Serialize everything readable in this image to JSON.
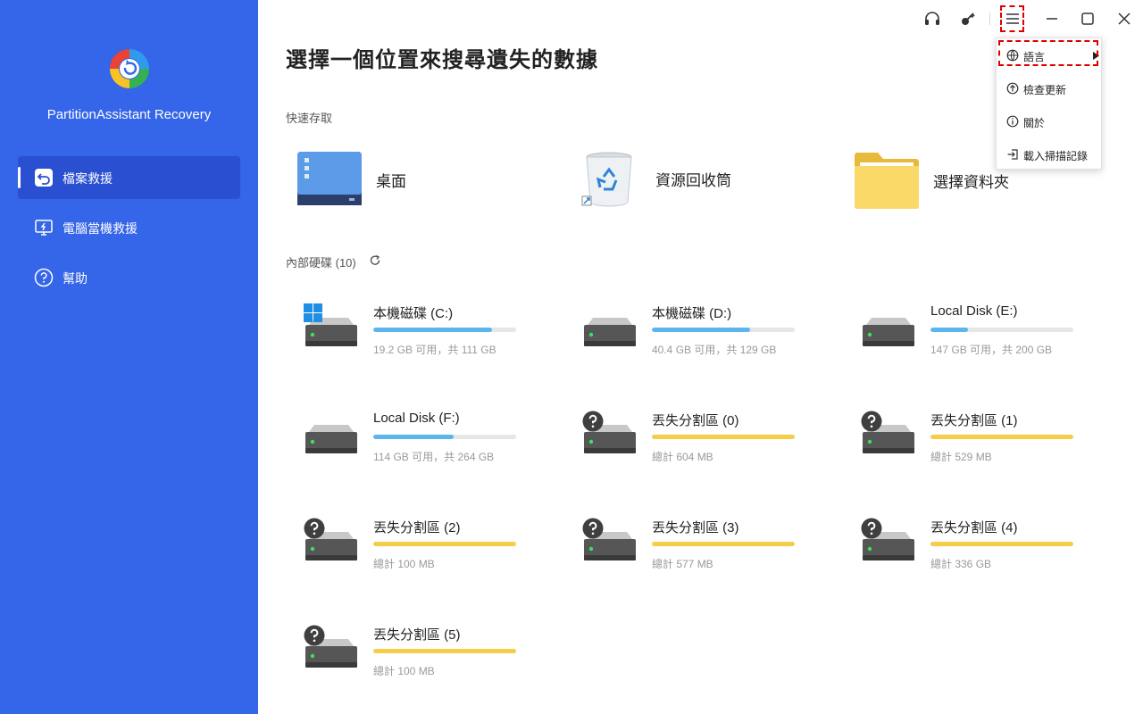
{
  "sidebar": {
    "app_name": "PartitionAssistant Recovery",
    "nav": [
      {
        "label": "檔案救援",
        "icon": "undo-file-icon",
        "active": true
      },
      {
        "label": "電腦當機救援",
        "icon": "monitor-crash-icon",
        "active": false
      },
      {
        "label": "幫助",
        "icon": "help-icon",
        "active": false
      }
    ]
  },
  "main": {
    "title": "選擇一個位置來搜尋遺失的數據",
    "quick_access_label": "快速存取",
    "quick_access": [
      {
        "label": "桌面",
        "icon": "desktop-icon"
      },
      {
        "label": "資源回收筒",
        "icon": "recycle-bin-icon"
      },
      {
        "label": "選擇資料夾",
        "icon": "folder-icon"
      }
    ],
    "disks_label": "內部硬碟 (10)",
    "disks": [
      {
        "name": "本機磁碟 (C:)",
        "info": "19.2 GB 可用，共 111 GB",
        "used": 0.83,
        "type": "system"
      },
      {
        "name": "本機磁碟 (D:)",
        "info": "40.4 GB 可用，共 129 GB",
        "used": 0.69,
        "type": "normal"
      },
      {
        "name": "Local Disk (E:)",
        "info": "147 GB 可用，共 200 GB",
        "used": 0.26,
        "type": "normal"
      },
      {
        "name": "Local Disk (F:)",
        "info": "114 GB 可用，共 264 GB",
        "used": 0.56,
        "type": "normal"
      },
      {
        "name": "丟失分割區 (0)",
        "info": "總計 604 MB",
        "used": 1.0,
        "type": "lost"
      },
      {
        "name": "丟失分割區 (1)",
        "info": "總計 529 MB",
        "used": 1.0,
        "type": "lost"
      },
      {
        "name": "丟失分割區 (2)",
        "info": "總計 100 MB",
        "used": 1.0,
        "type": "lost"
      },
      {
        "name": "丟失分割區 (3)",
        "info": "總計 577 MB",
        "used": 1.0,
        "type": "lost"
      },
      {
        "name": "丟失分割區 (4)",
        "info": "總計 336 GB",
        "used": 1.0,
        "type": "lost"
      },
      {
        "name": "丟失分割區 (5)",
        "info": "總計 100 MB",
        "used": 1.0,
        "type": "lost"
      }
    ]
  },
  "titlebar": {
    "icons": [
      "headset-icon",
      "key-icon",
      "menu-icon",
      "minimize-icon",
      "maximize-icon",
      "close-icon"
    ]
  },
  "menu": {
    "items": [
      {
        "label": "語言",
        "icon": "language-icon",
        "has_submenu": true
      },
      {
        "label": "檢查更新",
        "icon": "update-icon",
        "has_submenu": false
      },
      {
        "label": "關於",
        "icon": "info-icon",
        "has_submenu": false
      },
      {
        "label": "載入掃描記錄",
        "icon": "import-icon",
        "has_submenu": false
      }
    ]
  },
  "colors": {
    "sidebar": "#3565e8",
    "nav_active": "#2a4fd0",
    "capacity_bar": "#5cb6ee",
    "lost_bar": "#f5cd48",
    "highlight": "#e00000"
  }
}
